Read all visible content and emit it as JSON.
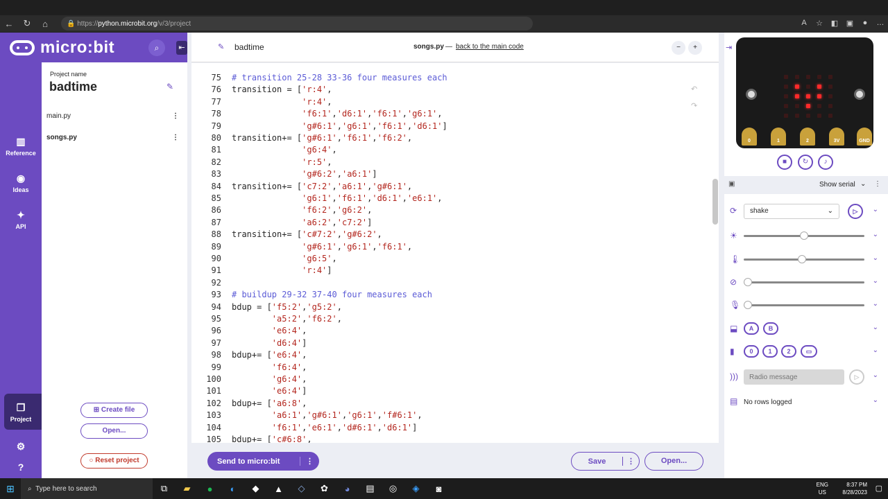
{
  "browser": {
    "url_prefix": "https://",
    "url_host": "python.microbit.org",
    "url_path": "/v/3/project"
  },
  "brand": {
    "name": "micro:bit"
  },
  "rail": {
    "reference": "Reference",
    "ideas": "Ideas",
    "api": "API",
    "project": "Project"
  },
  "project_panel": {
    "label": "Project name",
    "name": "badtime",
    "files": [
      "main.py",
      "songs.py"
    ],
    "create_file": "Create file",
    "open": "Open...",
    "reset": "Reset project"
  },
  "editor": {
    "project_title": "badtime",
    "file": "songs.py",
    "separator": "—",
    "back_link": "back to the main code",
    "zoom_out": "−",
    "zoom_in": "+",
    "lines": [
      {
        "n": "75",
        "t": "# transition 25-28 33-36 four measures each",
        "c": true
      },
      {
        "n": "76",
        "t": "transition = ['r:4',"
      },
      {
        "n": "77",
        "t": "              'r:4',"
      },
      {
        "n": "78",
        "t": "              'f6:1','d6:1','f6:1','g6:1',"
      },
      {
        "n": "79",
        "t": "              'g#6:1','g6:1','f6:1','d6:1']"
      },
      {
        "n": "80",
        "t": "transition+= ['g#6:1','f6:1','f6:2',"
      },
      {
        "n": "81",
        "t": "              'g6:4',"
      },
      {
        "n": "82",
        "t": "              'r:5',"
      },
      {
        "n": "83",
        "t": "              'g#6:2','a6:1']"
      },
      {
        "n": "84",
        "t": "transition+= ['c7:2','a6:1','g#6:1',"
      },
      {
        "n": "85",
        "t": "              'g6:1','f6:1','d6:1','e6:1',"
      },
      {
        "n": "86",
        "t": "              'f6:2','g6:2',"
      },
      {
        "n": "87",
        "t": "              'a6:2','c7:2']"
      },
      {
        "n": "88",
        "t": "transition+= ['c#7:2','g#6:2',"
      },
      {
        "n": "89",
        "t": "              'g#6:1','g6:1','f6:1',"
      },
      {
        "n": "90",
        "t": "              'g6:5',"
      },
      {
        "n": "91",
        "t": "              'r:4']"
      },
      {
        "n": "92",
        "t": ""
      },
      {
        "n": "93",
        "t": "# buildup 29-32 37-40 four measures each",
        "c": true
      },
      {
        "n": "94",
        "t": "bdup = ['f5:2','g5:2',"
      },
      {
        "n": "95",
        "t": "        'a5:2','f6:2',"
      },
      {
        "n": "96",
        "t": "        'e6:4',"
      },
      {
        "n": "97",
        "t": "        'd6:4']"
      },
      {
        "n": "98",
        "t": "bdup+= ['e6:4',"
      },
      {
        "n": "99",
        "t": "        'f6:4',"
      },
      {
        "n": "100",
        "t": "        'g6:4',"
      },
      {
        "n": "101",
        "t": "        'e6:4']"
      },
      {
        "n": "102",
        "t": "bdup+= ['a6:8',"
      },
      {
        "n": "103",
        "t": "        'a6:1','g#6:1','g6:1','f#6:1',"
      },
      {
        "n": "104",
        "t": "        'f6:1','e6:1','d#6:1','d6:1']"
      },
      {
        "n": "105",
        "t": "bdup+= ['c#6:8',"
      }
    ]
  },
  "actions": {
    "send": "Send to micro:bit",
    "save": "Save",
    "open": "Open..."
  },
  "simulator": {
    "pins": [
      "0",
      "1",
      "2",
      "3V",
      "GND"
    ],
    "show_serial": "Show serial",
    "gesture": "shake",
    "buttons": [
      "A",
      "B"
    ],
    "touch_pins": [
      "0",
      "1",
      "2"
    ],
    "radio_placeholder": "Radio message",
    "data_log": "No rows logged",
    "sliders": {
      "light": 0.5,
      "temperature": 0.48,
      "compass": 0.0,
      "sound": 0.0
    },
    "leds": [
      [
        0,
        0,
        0,
        0,
        0
      ],
      [
        0,
        1,
        0,
        1,
        0
      ],
      [
        0,
        1,
        1,
        1,
        0
      ],
      [
        0,
        0,
        1,
        0,
        0
      ],
      [
        0,
        0,
        0,
        0,
        0
      ]
    ]
  },
  "taskbar": {
    "search": "Type here to search",
    "lang1": "ENG",
    "lang2": "US",
    "time": "8:37 PM",
    "date": "8/28/2023"
  },
  "colors": {
    "brand": "#6c4bc1",
    "code_comment": "#5b5bd6",
    "code_string": "#b3261e"
  }
}
